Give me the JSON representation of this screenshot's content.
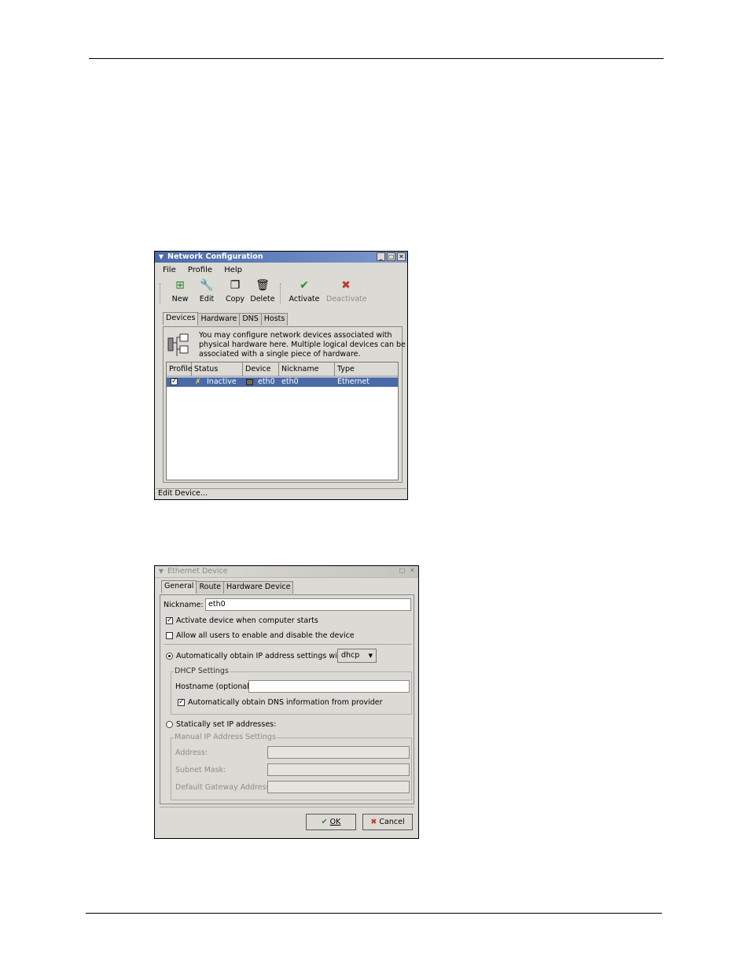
{
  "network_window": {
    "title": "Network Configuration",
    "menu": [
      "File",
      "Profile",
      "Help"
    ],
    "toolbar": [
      {
        "label": "New",
        "icon": "new-icon"
      },
      {
        "label": "Edit",
        "icon": "edit-wrench-icon"
      },
      {
        "label": "Copy",
        "icon": "copy-icon"
      },
      {
        "label": "Delete",
        "icon": "trash-icon"
      },
      {
        "label": "Activate",
        "icon": "checkmark-icon"
      },
      {
        "label": "Deactivate",
        "icon": "x-icon"
      }
    ],
    "tabs": [
      "Devices",
      "Hardware",
      "DNS",
      "Hosts"
    ],
    "description": [
      "You may configure network devices associated with",
      "physical hardware here.  Multiple logical devices can be",
      "associated with a single piece of hardware."
    ],
    "columns": [
      "Profile",
      "Status",
      "Device",
      "Nickname",
      "Type"
    ],
    "rows": [
      {
        "profile_checked": true,
        "status": "Inactive",
        "device": "eth0",
        "nickname": "eth0",
        "type": "Ethernet"
      }
    ],
    "status_bar": "Edit Device..."
  },
  "ethernet_window": {
    "title": "Ethernet Device",
    "tabs": [
      "General",
      "Route",
      "Hardware Device"
    ],
    "nickname_label": "Nickname:",
    "nickname_value": "eth0",
    "activate_on_start": {
      "label": "Activate device when computer starts",
      "checked": true
    },
    "allow_users": {
      "label": "Allow all users to enable and disable the device",
      "checked": false
    },
    "auto_ip": {
      "label": "Automatically obtain IP address settings with:",
      "selected": true,
      "method": "dhcp"
    },
    "dhcp_group": "DHCP Settings",
    "hostname_label": "Hostname (optional):",
    "hostname_value": "",
    "auto_dns": {
      "label": "Automatically obtain DNS information from provider",
      "checked": true
    },
    "static_ip": {
      "label": "Statically set IP addresses:",
      "selected": false
    },
    "manual_group": "Manual IP Address Settings",
    "address_label": "Address:",
    "subnet_label": "Subnet Mask:",
    "gateway_label": "Default Gateway Address:",
    "ok_label": "OK",
    "cancel_label": "Cancel"
  }
}
